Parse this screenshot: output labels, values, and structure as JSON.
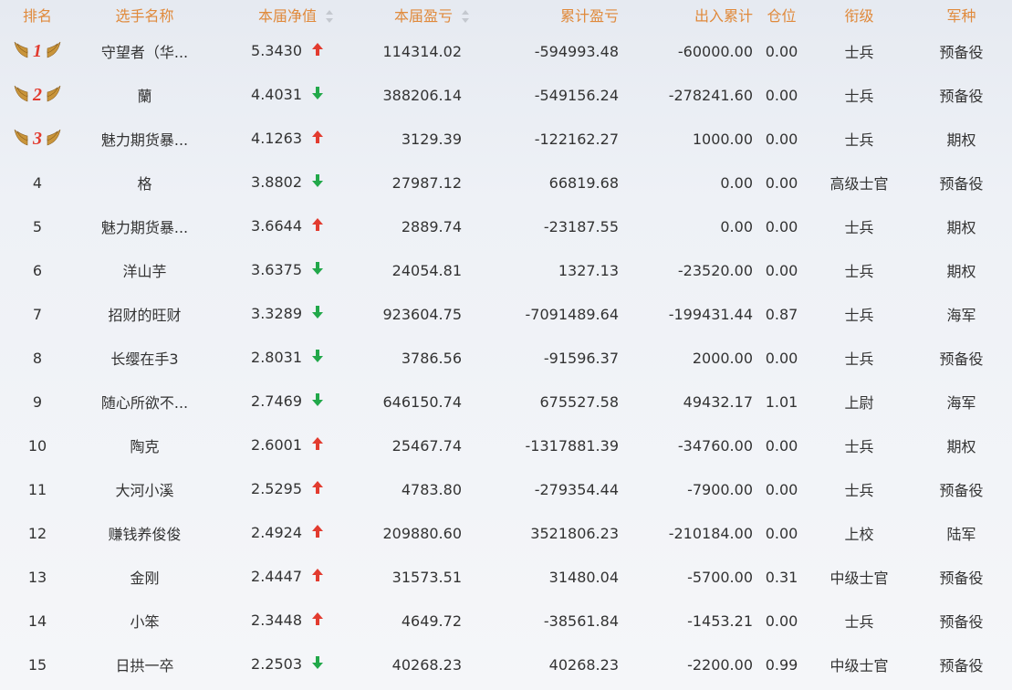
{
  "headers": {
    "rank": "排名",
    "name": "选手名称",
    "nav": "本届净值",
    "pnl": "本届盈亏",
    "cum_pnl": "累计盈亏",
    "io": "出入累计",
    "pos": "仓位",
    "grade": "衔级",
    "branch": "军种"
  },
  "colors": {
    "up": "#e23b2f",
    "down": "#22a84a",
    "header": "#e08a3c"
  },
  "rows": [
    {
      "rank": "1",
      "name": "守望者（华...",
      "nav": "5.3430",
      "dir": "up",
      "pnl": "114314.02",
      "cum_pnl": "-594993.48",
      "io": "-60000.00",
      "pos": "0.00",
      "grade": "士兵",
      "branch": "预备役"
    },
    {
      "rank": "2",
      "name": "蘭",
      "nav": "4.4031",
      "dir": "down",
      "pnl": "388206.14",
      "cum_pnl": "-549156.24",
      "io": "-278241.60",
      "pos": "0.00",
      "grade": "士兵",
      "branch": "预备役"
    },
    {
      "rank": "3",
      "name": "魅力期货暴...",
      "nav": "4.1263",
      "dir": "up",
      "pnl": "3129.39",
      "cum_pnl": "-122162.27",
      "io": "1000.00",
      "pos": "0.00",
      "grade": "士兵",
      "branch": "期权"
    },
    {
      "rank": "4",
      "name": "格",
      "nav": "3.8802",
      "dir": "down",
      "pnl": "27987.12",
      "cum_pnl": "66819.68",
      "io": "0.00",
      "pos": "0.00",
      "grade": "高级士官",
      "branch": "预备役"
    },
    {
      "rank": "5",
      "name": "魅力期货暴...",
      "nav": "3.6644",
      "dir": "up",
      "pnl": "2889.74",
      "cum_pnl": "-23187.55",
      "io": "0.00",
      "pos": "0.00",
      "grade": "士兵",
      "branch": "期权"
    },
    {
      "rank": "6",
      "name": "洋山芋",
      "nav": "3.6375",
      "dir": "down",
      "pnl": "24054.81",
      "cum_pnl": "1327.13",
      "io": "-23520.00",
      "pos": "0.00",
      "grade": "士兵",
      "branch": "期权"
    },
    {
      "rank": "7",
      "name": "招财的旺财",
      "nav": "3.3289",
      "dir": "down",
      "pnl": "923604.75",
      "cum_pnl": "-7091489.64",
      "io": "-199431.44",
      "pos": "0.87",
      "grade": "士兵",
      "branch": "海军"
    },
    {
      "rank": "8",
      "name": "长缨在手3",
      "nav": "2.8031",
      "dir": "down",
      "pnl": "3786.56",
      "cum_pnl": "-91596.37",
      "io": "2000.00",
      "pos": "0.00",
      "grade": "士兵",
      "branch": "预备役"
    },
    {
      "rank": "9",
      "name": "随心所欲不...",
      "nav": "2.7469",
      "dir": "down",
      "pnl": "646150.74",
      "cum_pnl": "675527.58",
      "io": "49432.17",
      "pos": "1.01",
      "grade": "上尉",
      "branch": "海军"
    },
    {
      "rank": "10",
      "name": "陶克",
      "nav": "2.6001",
      "dir": "up",
      "pnl": "25467.74",
      "cum_pnl": "-1317881.39",
      "io": "-34760.00",
      "pos": "0.00",
      "grade": "士兵",
      "branch": "期权"
    },
    {
      "rank": "11",
      "name": "大河小溪",
      "nav": "2.5295",
      "dir": "up",
      "pnl": "4783.80",
      "cum_pnl": "-279354.44",
      "io": "-7900.00",
      "pos": "0.00",
      "grade": "士兵",
      "branch": "预备役"
    },
    {
      "rank": "12",
      "name": "赚钱养俊俊",
      "nav": "2.4924",
      "dir": "up",
      "pnl": "209880.60",
      "cum_pnl": "3521806.23",
      "io": "-210184.00",
      "pos": "0.00",
      "grade": "上校",
      "branch": "陆军"
    },
    {
      "rank": "13",
      "name": "金刚",
      "nav": "2.4447",
      "dir": "up",
      "pnl": "31573.51",
      "cum_pnl": "31480.04",
      "io": "-5700.00",
      "pos": "0.31",
      "grade": "中级士官",
      "branch": "预备役"
    },
    {
      "rank": "14",
      "name": "小笨",
      "nav": "2.3448",
      "dir": "up",
      "pnl": "4649.72",
      "cum_pnl": "-38561.84",
      "io": "-1453.21",
      "pos": "0.00",
      "grade": "士兵",
      "branch": "预备役"
    },
    {
      "rank": "15",
      "name": "日拱一卒",
      "nav": "2.2503",
      "dir": "down",
      "pnl": "40268.23",
      "cum_pnl": "40268.23",
      "io": "-2200.00",
      "pos": "0.99",
      "grade": "中级士官",
      "branch": "预备役"
    }
  ]
}
